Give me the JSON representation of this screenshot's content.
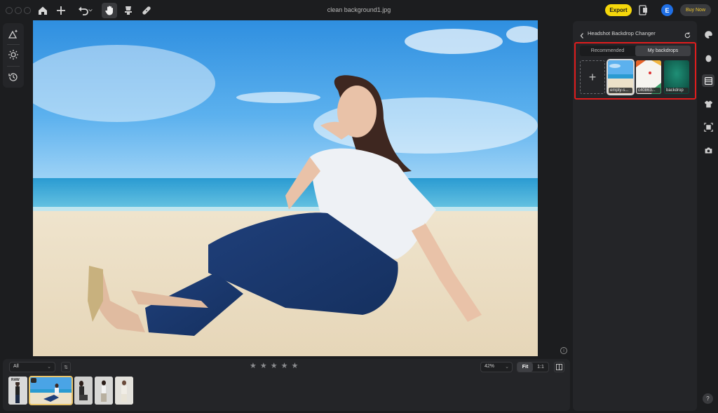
{
  "window": {
    "file_title": "clean background1.jpg"
  },
  "toolbar": {
    "export_label": "Export",
    "avatar_initial": "E",
    "buy_now_label": "Buy Now"
  },
  "bottom_bar": {
    "filter_value": "All",
    "rating_stars": 5,
    "zoom_value": "42%",
    "fit_label": "Fit",
    "one_to_one_label": "1:1",
    "raw_badge": "RAW"
  },
  "right_panel": {
    "title": "Headshot Backdrop Changer",
    "tabs": [
      {
        "label": "Recommended",
        "active": false
      },
      {
        "label": "My backdrops",
        "active": true
      }
    ],
    "backdrops": [
      {
        "label": "empty-s...",
        "selected": true
      },
      {
        "label": "c40863...",
        "selected": false
      },
      {
        "label": "backdrop",
        "selected": false
      }
    ]
  },
  "colors": {
    "accent_yellow": "#f5d70b",
    "highlight_red": "#e01d1d",
    "avatar_blue": "#1f6fe5"
  }
}
